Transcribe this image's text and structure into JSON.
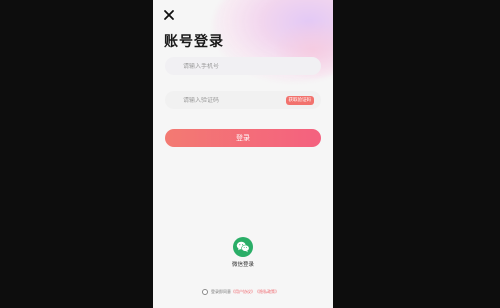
{
  "header": {
    "title": "账号登录"
  },
  "phone_field": {
    "placeholder": "请输入手机号"
  },
  "code_field": {
    "placeholder": "请输入验证码",
    "get_code_label": "获取验证码"
  },
  "login_button": {
    "label": "登录"
  },
  "wechat": {
    "label": "微信登录",
    "icon": "wechat-icon"
  },
  "agreement": {
    "prefix": "登录即同意",
    "user_agreement": "《用户协议》",
    "privacy_policy": "《隐私政策》"
  },
  "colors": {
    "accent": "#f2726d",
    "button_gradient_start": "#f37a72",
    "button_gradient_end": "#f4617f",
    "wechat_green": "#2aae67"
  }
}
